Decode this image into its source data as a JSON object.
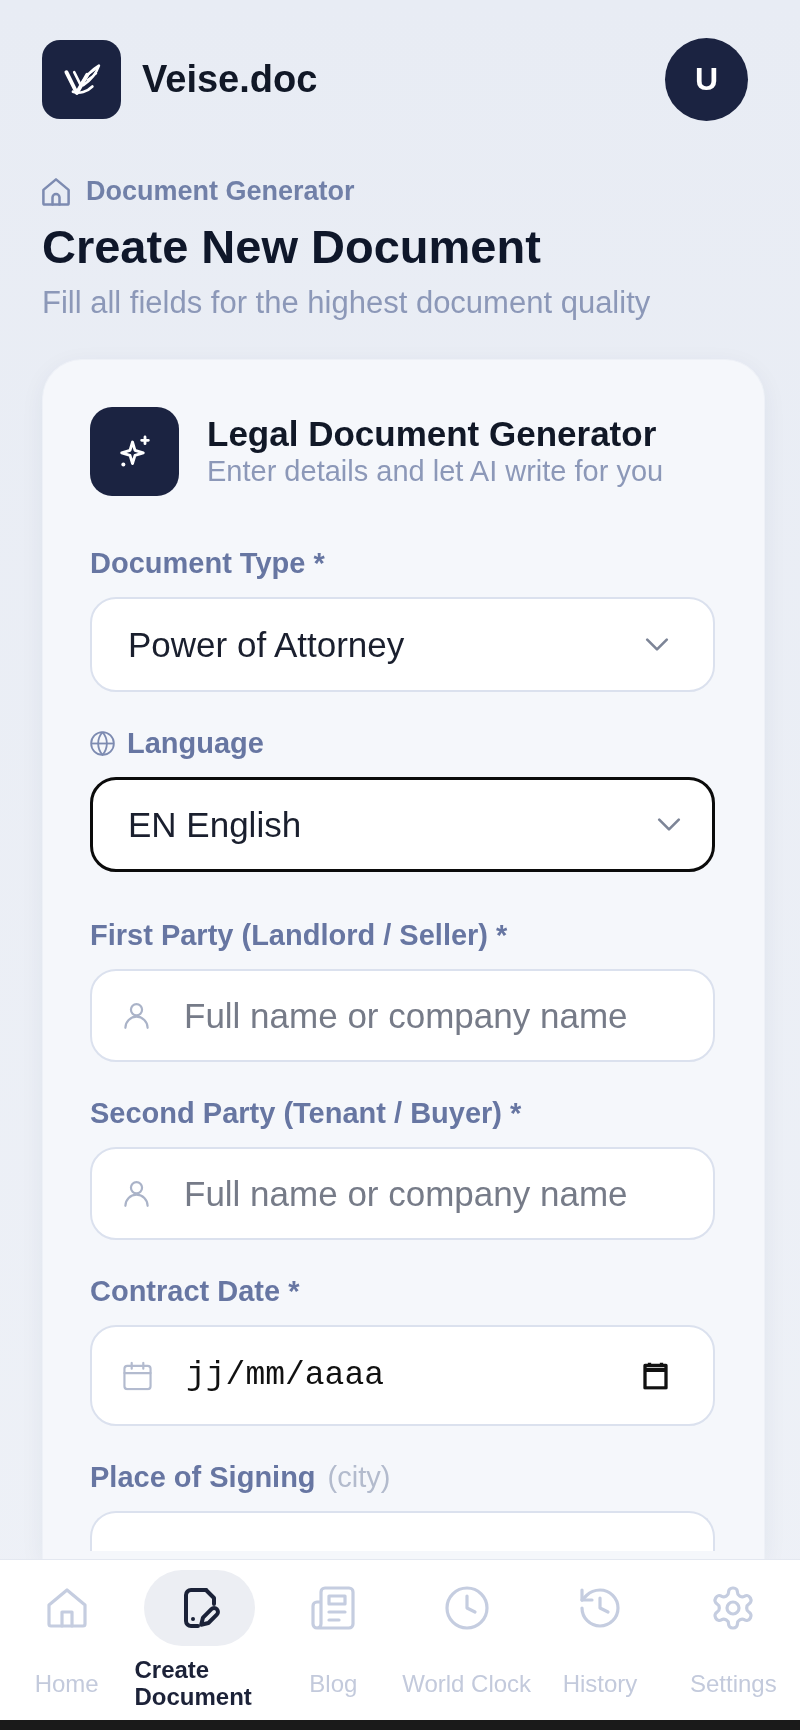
{
  "header": {
    "app_name": "Veise.doc",
    "avatar_initial": "U"
  },
  "breadcrumb": {
    "label": "Document Generator"
  },
  "page": {
    "title": "Create New Document",
    "subtitle": "Fill all fields for the highest document quality"
  },
  "card": {
    "title": "Legal Document Generator",
    "subtitle": "Enter details and let AI write for you",
    "fields": [
      {
        "kind": "select",
        "label": "Document Type *",
        "value": "Power of Attorney",
        "focused": false
      },
      {
        "kind": "language-select",
        "label": "Language",
        "value": "EN English",
        "focused": true
      },
      {
        "kind": "text",
        "label": "First Party (Landlord / Seller) *",
        "placeholder": "Full name or company name",
        "focused": false
      },
      {
        "kind": "text",
        "label": "Second Party (Tenant / Buyer) *",
        "placeholder": "Full name or company name",
        "focused": false
      },
      {
        "kind": "date",
        "label": "Contract Date *",
        "placeholder": "jj/mm/aaaa",
        "focused": false
      },
      {
        "kind": "text",
        "label": "Place of Signing",
        "hint": "(city)",
        "focused": false
      }
    ]
  },
  "bottom_nav": [
    {
      "label": "Home",
      "selected": false
    },
    {
      "label": "Create Document",
      "selected": true
    },
    {
      "label": "Blog",
      "selected": false
    },
    {
      "label": "World Clock",
      "selected": false
    },
    {
      "label": "History",
      "selected": false
    },
    {
      "label": "Settings",
      "selected": false
    }
  ]
}
